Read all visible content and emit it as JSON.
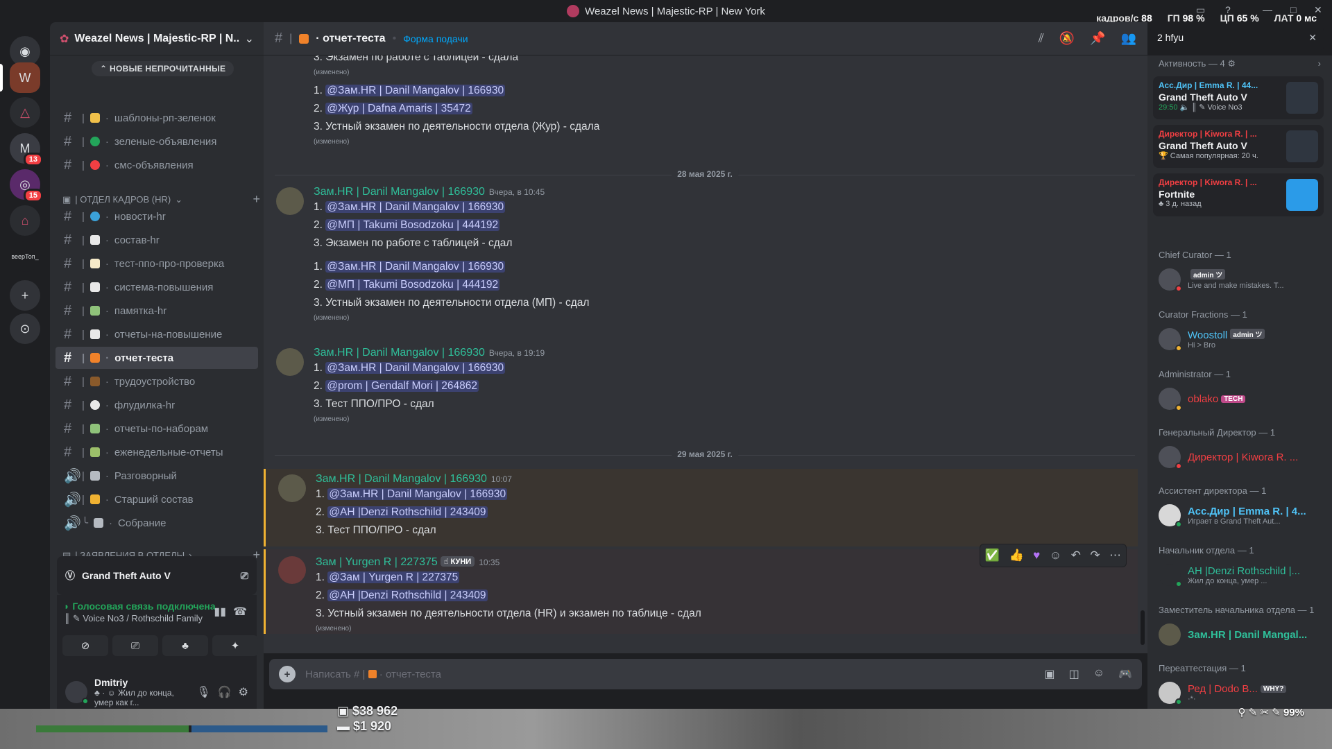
{
  "window": {
    "title": "Weazel News | Majestic-RP | New York",
    "stats": [
      {
        "label": "кадров/с",
        "value": "88"
      },
      {
        "label": "ГП",
        "value": "98 %"
      },
      {
        "label": "ЦП",
        "value": "65 %"
      },
      {
        "label": "ЛАТ",
        "value": "0 мс"
      }
    ]
  },
  "rail": {
    "servers": [
      {
        "icon": "discord-icon",
        "badge": ""
      },
      {
        "icon": "server-weazel-icon",
        "badge": ""
      },
      {
        "icon": "server-triangle-icon",
        "badge": ""
      },
      {
        "icon": "server-majestic-icon",
        "badge": "13"
      },
      {
        "icon": "server-pink-icon",
        "badge": "15"
      },
      {
        "icon": "server-store-icon",
        "badge": ""
      },
      {
        "icon": "server-text-icon",
        "badge": "",
        "label": "веерТоп_"
      }
    ]
  },
  "sidebar": {
    "server_name": "Weazel News | Majestic-RP | N...",
    "new_unread": "НОВЫЕ НЕПРОЧИТАННЫЕ",
    "top_channels": [
      {
        "label": "шаблоны-рп-зеленок",
        "color": "#f0c04a"
      },
      {
        "label": "зеленые-объявления",
        "color": "#23a55a"
      },
      {
        "label": "смс-объявления",
        "color": "#f23f43"
      }
    ],
    "category_hr": "| ОТДЕЛ КАДРОВ (HR)",
    "hr_channels": [
      {
        "label": "новости-hr",
        "color": "#3ba1d8",
        "voice": false
      },
      {
        "label": "состав-hr",
        "color": "#e8e8e8",
        "voice": false
      },
      {
        "label": "тест-ппо-про-проверка",
        "color": "#f5e9c8",
        "voice": false
      },
      {
        "label": "система-повышения",
        "color": "#e8e8e8",
        "voice": false
      },
      {
        "label": "памятка-hr",
        "color": "#8fc27a",
        "voice": false
      },
      {
        "label": "отчеты-на-повышение",
        "color": "#e8e8e8",
        "voice": false
      },
      {
        "label": "отчет-теста",
        "color": "#f0822a",
        "voice": false,
        "active": true
      },
      {
        "label": "трудоустройство",
        "color": "#8a5a2b",
        "voice": false
      },
      {
        "label": "флудилка-hr",
        "color": "#e8e8e8",
        "voice": false
      },
      {
        "label": "отчеты-по-наборам",
        "color": "#8fc27a",
        "voice": false
      },
      {
        "label": "еженедельные-отчеты",
        "color": "#9cbf6a",
        "voice": false
      },
      {
        "label": "Разговорный",
        "color": "#b5bac1",
        "voice": true
      },
      {
        "label": "Старший состав",
        "color": "#f0b232",
        "voice": true
      },
      {
        "label": "Собрание",
        "color": "#b5bac1",
        "voice": true
      }
    ],
    "category_applications": "| ЗАЯВЛЕНИЯ В ОТДЕЛЫ"
  },
  "activity_card": {
    "game": "Grand Theft Auto V"
  },
  "voice": {
    "connected": "Голосовая связь подключена",
    "channel": "Voice No3 / Rothschild Family"
  },
  "user": {
    "name": "Dmitriy",
    "status": "Жил до конца, умер как г..."
  },
  "chat_header": {
    "channel": "отчет-теста",
    "topic": "Форма подачи"
  },
  "search": {
    "value": "2 hfyu"
  },
  "messages": {
    "top_partial": {
      "line0": "3. Экзамен по работе с таблицей - сдала",
      "edited0": "(изменено)",
      "line1_num": "1.",
      "line1": "@Зам.HR | Danil Mangalov | 166930",
      "line2_num": "2.",
      "line2": "@Жур | Dafna Amaris | 35472",
      "line3": "3. Устный экзамен по деятельности отдела (Жур) - сдала",
      "edited1": "(изменено)"
    },
    "date1": "28 мая 2025 г.",
    "m1": {
      "author": "Зам.HR | Danil Mangalov | 166930",
      "time": "Вчера, в 10:45",
      "a_num": "1.",
      "a": "@Зам.HR | Danil Mangalov | 166930",
      "b_num": "2.",
      "b": "@МП | Takumi Bosodzoku | 444192",
      "c": "3. Экзамен по работе с таблицей - сдал",
      "d_num": "1.",
      "d": "@Зам.HR | Danil Mangalov | 166930",
      "e_num": "2.",
      "e": "@МП | Takumi Bosodzoku | 444192",
      "f": "3. Устный экзамен по деятельности отдела (МП) - сдал",
      "edited": "(изменено)"
    },
    "m2": {
      "author": "Зам.HR | Danil Mangalov | 166930",
      "time": "Вчера, в 19:19",
      "a_num": "1.",
      "a": "@Зам.HR | Danil Mangalov | 166930",
      "b_num": "2.",
      "b": "@prom | Gendalf Mori | 264862",
      "c": "3. Тест ППО/ПРО - сдал",
      "edited": "(изменено)"
    },
    "date2": "29 мая 2025 г.",
    "m3": {
      "author": "Зам.HR | Danil Mangalov | 166930",
      "time": "10:07",
      "a_num": "1.",
      "a": "@Зам.HR | Danil Mangalov | 166930",
      "b_num": "2.",
      "b": "@АН |Denzi Rothschild | 243409",
      "c": "3. Тест ППО/ПРО - сдал"
    },
    "m4": {
      "author": "Зам | Yurgen R | 227375",
      "tag": "КУНИ",
      "time": "10:35",
      "a_num": "1.",
      "a": "@Зам | Yurgen R | 227375",
      "b_num": "2.",
      "b": "@АН |Denzi Rothschild | 243409",
      "c": "3. Устный экзамен по деятельности отдела (HR) и экзамен по таблице - сдал",
      "edited": "(изменено)"
    }
  },
  "composer": {
    "placeholder": "Написать # |",
    "channel": "отчет-теста"
  },
  "members": {
    "activity_header": "Активность — 4",
    "activities": [
      {
        "who": "Асс.Дир | Emma R. | 44...",
        "who_color": "#4fc3f7",
        "game": "Grand Theft Auto V",
        "sub": "29:50",
        "sub2": "Voice No3"
      },
      {
        "who": "Директор | Kiwora R. | ...",
        "who_color": "#f23f43",
        "game": "Grand Theft Auto V",
        "sub": "Самая популярная: 20 ч."
      },
      {
        "who": "Директор | Kiwora R. | ...",
        "who_color": "#f23f43",
        "game": "Fortnite",
        "sub": "3 д. назад"
      }
    ],
    "groups": [
      {
        "title": "Chief Curator — 1",
        "name": "",
        "badge": "admin ツ",
        "status": "Live and make mistakes. T...",
        "color": "#dbdee1"
      },
      {
        "title": "Curator Fractions — 1",
        "name": "Woostoll",
        "badge": "admin ツ",
        "status": "Hi > Bro",
        "color": "#4fc3f7"
      },
      {
        "title": "Administrator — 1",
        "name": "oblako",
        "badge": "TECH",
        "status": "",
        "color": "#f23f43"
      },
      {
        "title": "Генеральный Директор — 1",
        "name": "Директор | Kiwora R. ...",
        "badge": "",
        "status": "",
        "color": "#f23f43"
      },
      {
        "title": "Ассистент директора — 1",
        "name": "Асс.Дир | Emma R. | 4...",
        "badge": "",
        "status": "Играет в Grand Theft Aut...",
        "color": "#4fc3f7"
      },
      {
        "title": "Начальник отдела — 1",
        "name": "АН |Denzi Rothschild |...",
        "badge": "",
        "status": "Жил до конца, умер ...",
        "color": "#2fbf9a"
      },
      {
        "title": "Заместитель начальника отдела — 1",
        "name": "Зам.HR | Danil Mangal...",
        "badge": "",
        "status": "",
        "color": "#2fbf9a"
      },
      {
        "title": "Переаттестация — 1",
        "name": "Ред | Dodo B...",
        "badge": "WHY?",
        "status": "·*·",
        "color": "#f23f43"
      }
    ]
  },
  "hud": {
    "cash": "$38 962",
    "bank": "$1 920",
    "battery": "99%"
  }
}
